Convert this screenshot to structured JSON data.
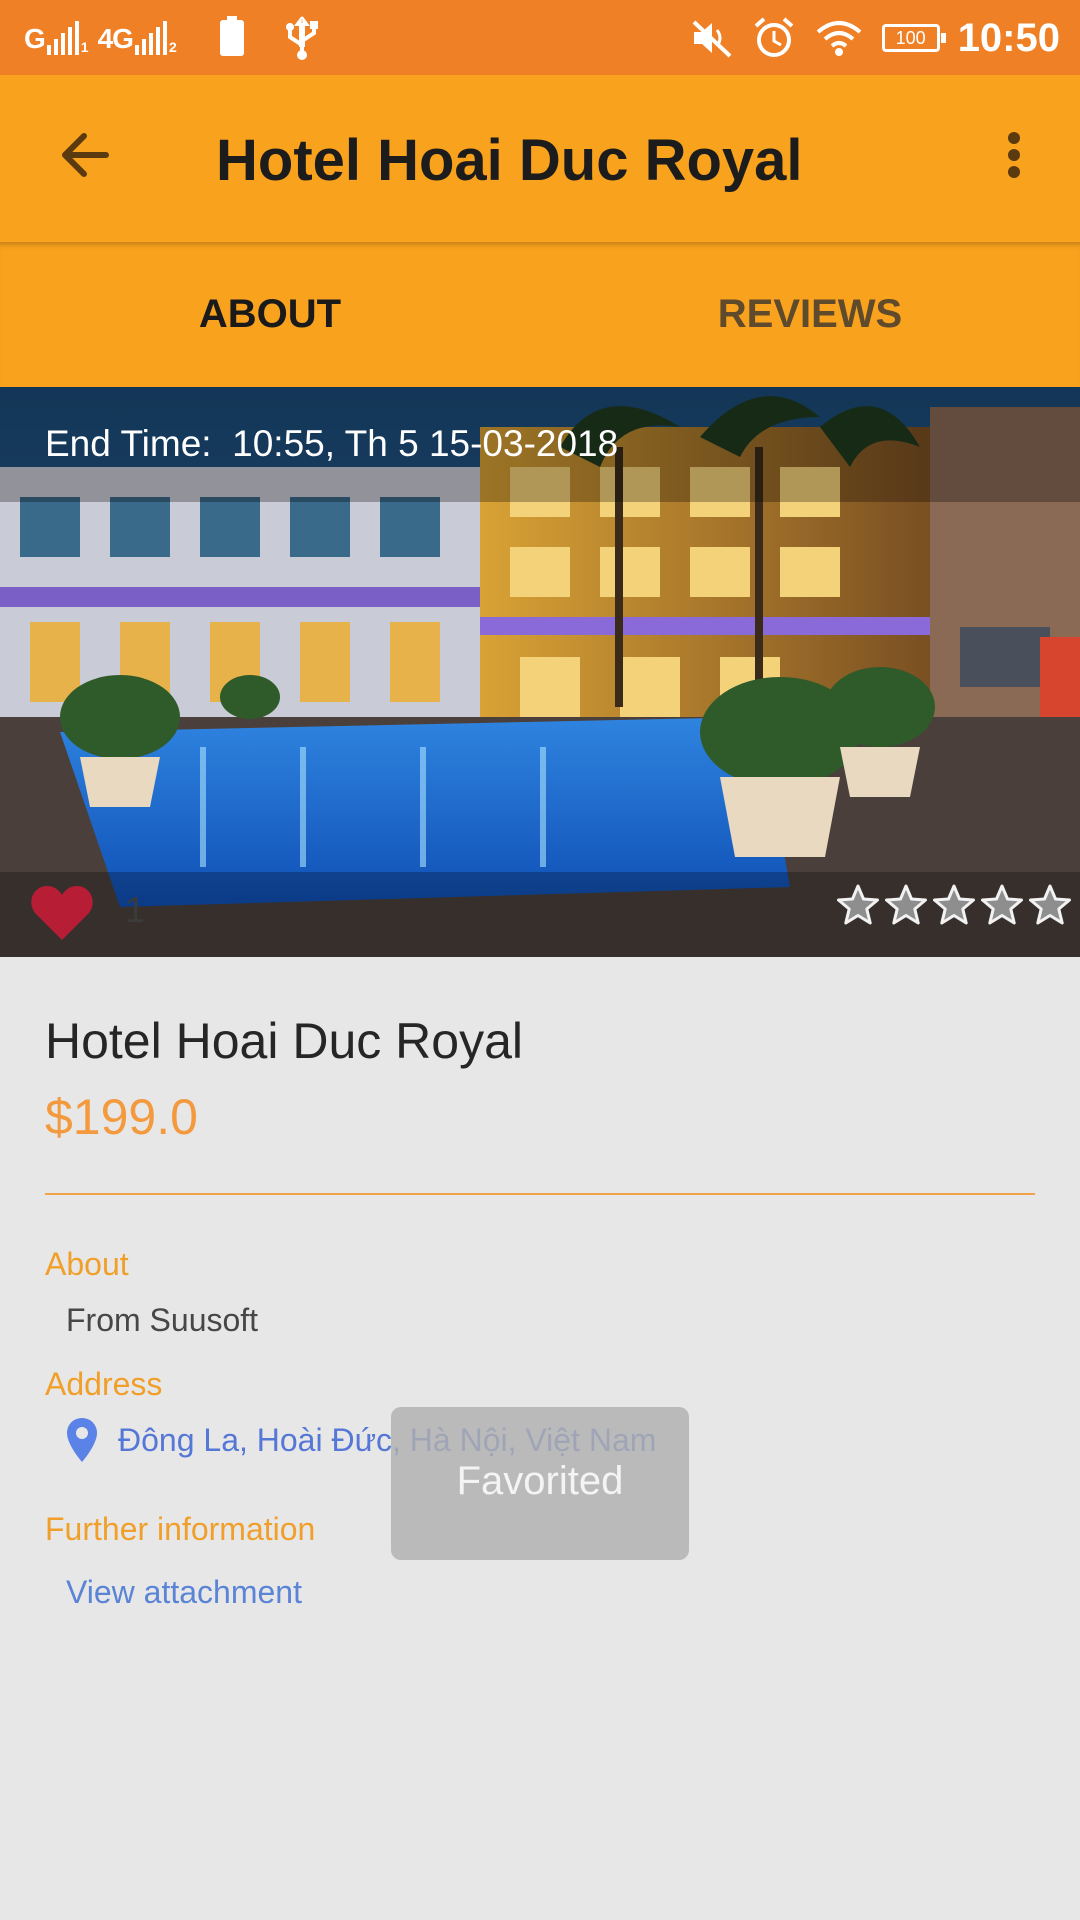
{
  "status_bar": {
    "signal_1": "G",
    "signal_1_sub": "1",
    "signal_2": "4G",
    "signal_2_sub": "2",
    "battery_level": "100",
    "time": "10:50"
  },
  "app_bar": {
    "title": "Hotel Hoai Duc Royal",
    "back_icon": "arrow-left-icon",
    "more_icon": "more-vert-icon"
  },
  "tabs": [
    {
      "label": "ABOUT",
      "active": true
    },
    {
      "label": "REVIEWS",
      "active": false
    }
  ],
  "hero": {
    "end_time_label": "End Time:",
    "end_time_value": "10:55, Th 5 15-03-2018",
    "like_count": "1",
    "rating_stars_total": 5,
    "rating_stars_filled": 0
  },
  "details": {
    "name": "Hotel Hoai Duc Royal",
    "price": "$199.0",
    "about_label": "About",
    "about_text": "From Suusoft",
    "address_label": "Address",
    "address_text": "Đông La, Hoài Đức, Hà Nội, Việt Nam",
    "further_label": "Further information",
    "attachment_link": "View attachment"
  },
  "toast": {
    "text": "Favorited"
  },
  "colors": {
    "status_bar": "#f08025",
    "app_bar": "#f9a21d",
    "accent": "#f39a3e",
    "link": "#5577d6",
    "heart": "#b81d36"
  }
}
